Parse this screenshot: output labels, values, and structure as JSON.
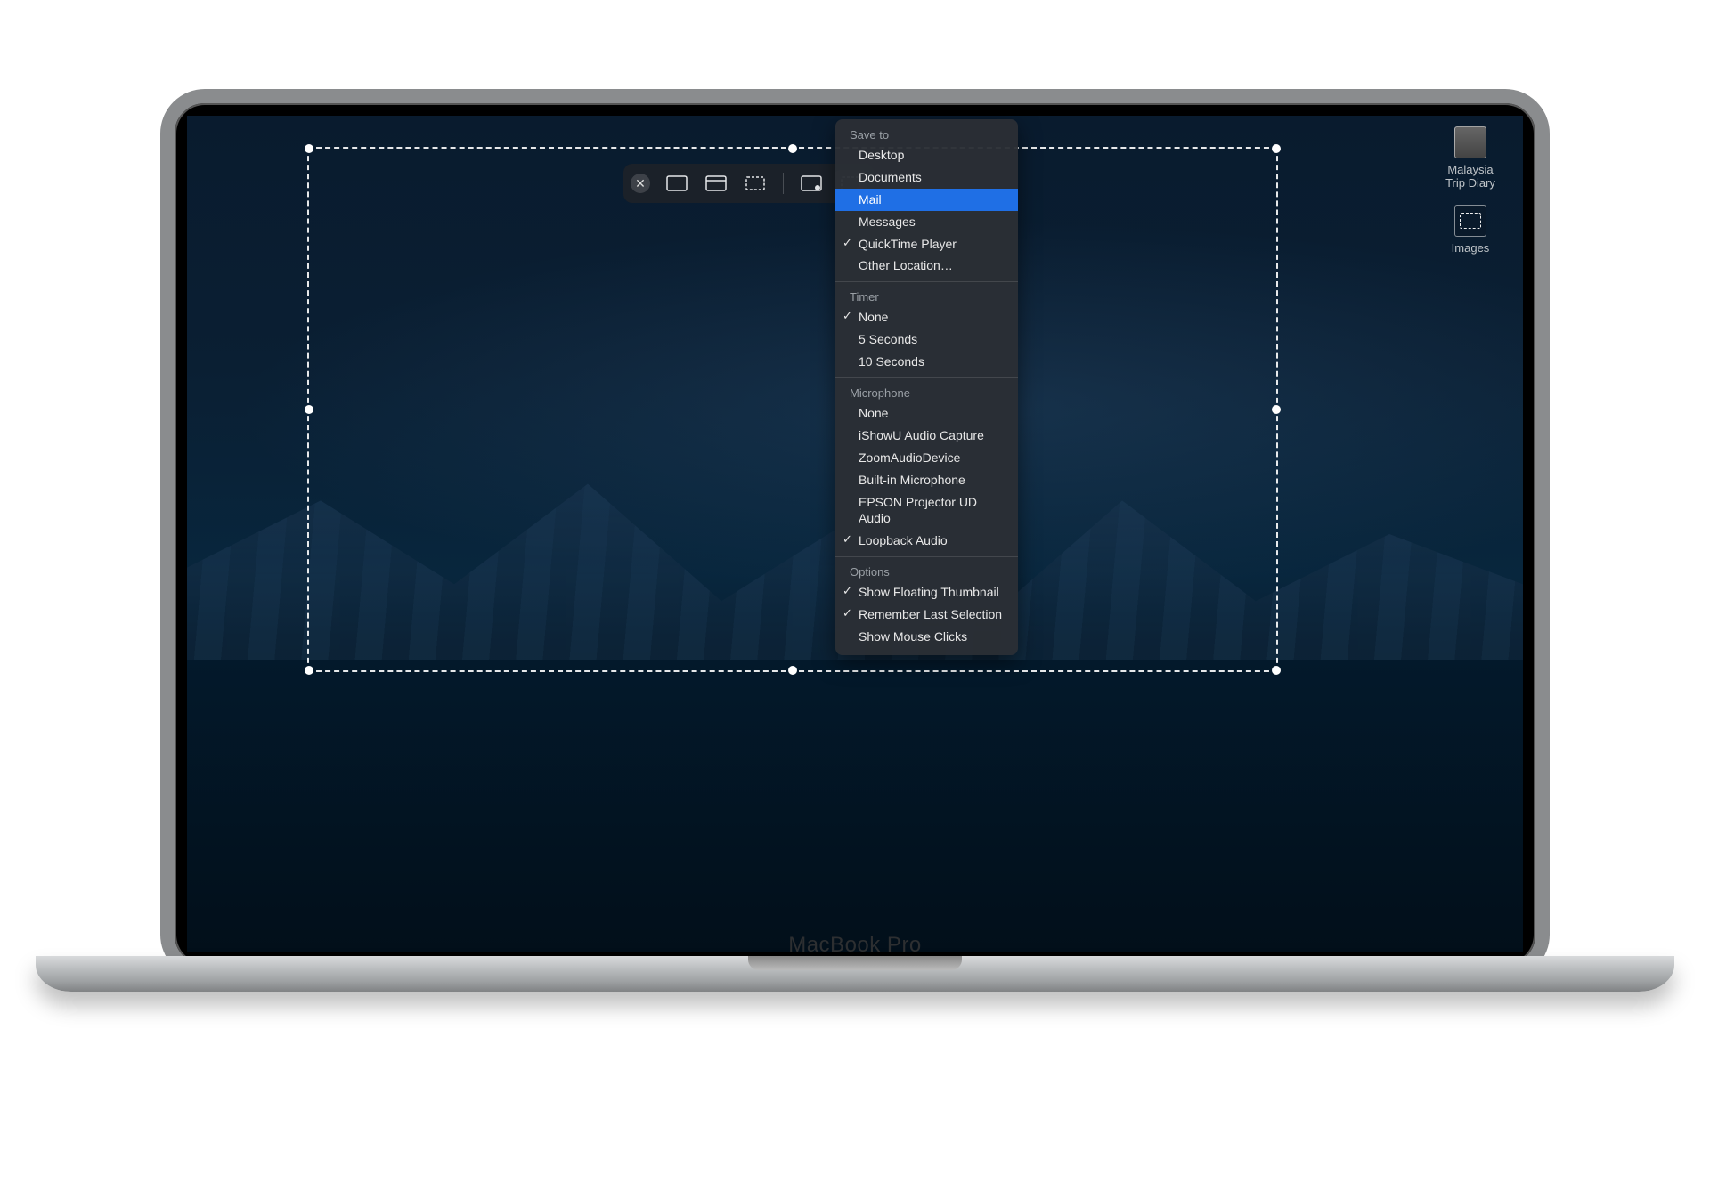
{
  "device": {
    "brand": "MacBook Pro"
  },
  "desktop_icons": [
    {
      "label": "Malaysia\nTrip Diary",
      "kind": "doc"
    },
    {
      "label": "Images",
      "kind": "folder"
    }
  ],
  "toolbar": {
    "close_title": "Close",
    "buttons": [
      {
        "name": "capture-entire-screen",
        "title": "Capture Entire Screen"
      },
      {
        "name": "capture-selected-window",
        "title": "Capture Selected Window"
      },
      {
        "name": "capture-selected-portion",
        "title": "Capture Selected Portion"
      },
      {
        "name": "record-entire-screen",
        "title": "Record Entire Screen"
      },
      {
        "name": "record-selected-portion",
        "title": "Record Selected Portion",
        "active": true
      }
    ]
  },
  "menu": {
    "sections": [
      {
        "title": "Save to",
        "items": [
          {
            "label": "Desktop"
          },
          {
            "label": "Documents"
          },
          {
            "label": "Mail",
            "highlight": true
          },
          {
            "label": "Messages"
          },
          {
            "label": "QuickTime Player",
            "checked": true
          },
          {
            "label": "Other Location…"
          }
        ]
      },
      {
        "title": "Timer",
        "items": [
          {
            "label": "None",
            "checked": true
          },
          {
            "label": "5 Seconds"
          },
          {
            "label": "10 Seconds"
          }
        ]
      },
      {
        "title": "Microphone",
        "items": [
          {
            "label": "None"
          },
          {
            "label": "iShowU Audio Capture"
          },
          {
            "label": "ZoomAudioDevice"
          },
          {
            "label": "Built-in Microphone"
          },
          {
            "label": "EPSON Projector UD Audio"
          },
          {
            "label": "Loopback Audio",
            "checked": true
          }
        ]
      },
      {
        "title": "Options",
        "items": [
          {
            "label": "Show Floating Thumbnail",
            "checked": true
          },
          {
            "label": "Remember Last Selection",
            "checked": true
          },
          {
            "label": "Show Mouse Clicks"
          }
        ]
      }
    ]
  }
}
